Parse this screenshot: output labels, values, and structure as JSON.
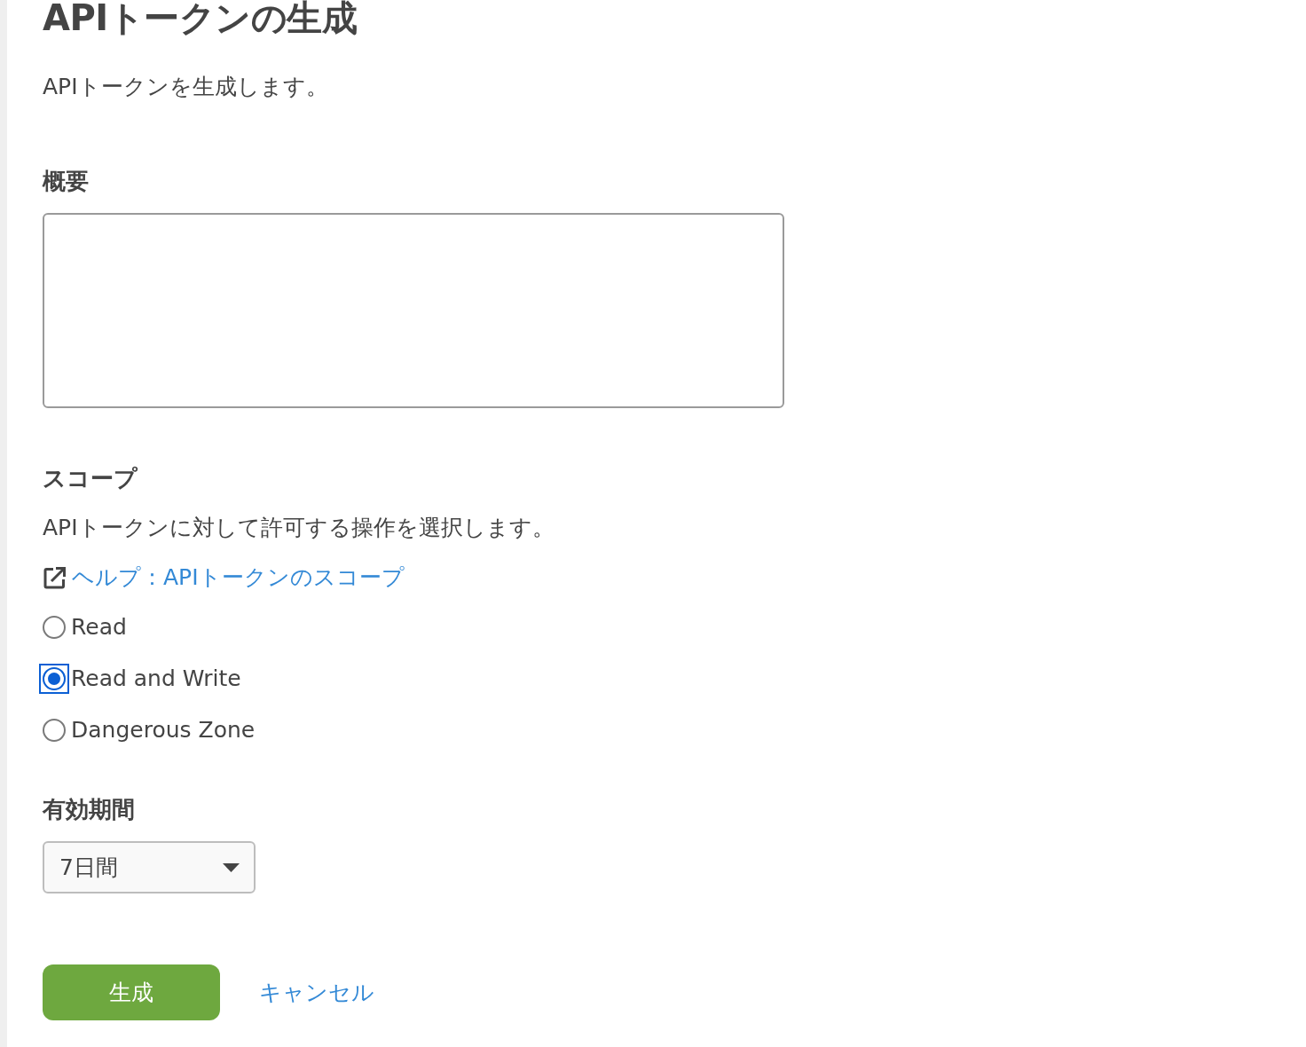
{
  "page": {
    "title": "APIトークンの生成",
    "description": "APIトークンを生成します。"
  },
  "summary": {
    "label": "概要"
  },
  "scope": {
    "label": "スコープ",
    "description": "APIトークンに対して許可する操作を選択します。",
    "help_link": "ヘルプ：APIトークンのスコープ",
    "options": [
      {
        "label": "Read",
        "selected": false,
        "focused": false
      },
      {
        "label": "Read and Write",
        "selected": true,
        "focused": true
      },
      {
        "label": "Dangerous Zone",
        "selected": false,
        "focused": false
      }
    ]
  },
  "expiry": {
    "label": "有効期間",
    "value": "7日間"
  },
  "actions": {
    "submit": "生成",
    "cancel": "キャンセル"
  }
}
